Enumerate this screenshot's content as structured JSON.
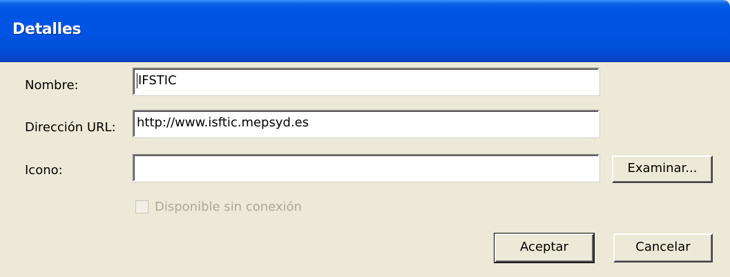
{
  "window": {
    "title": "Detalles"
  },
  "form": {
    "name_label": "Nombre:",
    "name_value": "IFSTIC",
    "url_label": "Dirección URL:",
    "url_value": "http://www.isftic.mepsyd.es",
    "icon_label": "Icono:",
    "icon_value": "",
    "browse_button": "Examinar...",
    "offline_checkbox": {
      "label": "Disponible sin conexión",
      "checked": false,
      "enabled": false
    }
  },
  "buttons": {
    "accept": "Aceptar",
    "cancel": "Cancelar"
  },
  "colors": {
    "titlebar": "#0054e3",
    "dialog_bg": "#ece9d8",
    "disabled_text": "#aca899"
  }
}
